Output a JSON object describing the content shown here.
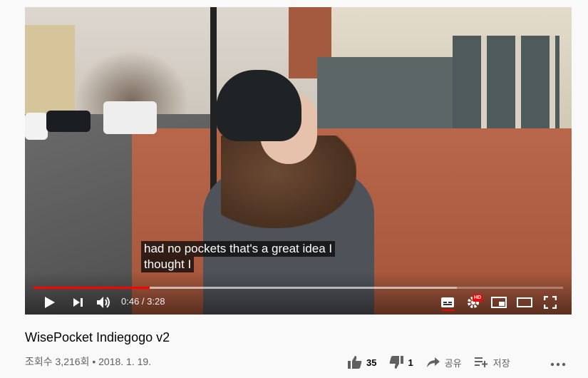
{
  "video": {
    "caption_line1": "had no pockets that's a great idea I",
    "caption_line2": "thought I",
    "current_time": "0:46",
    "duration": "3:28",
    "time_display": "0:46 / 3:28",
    "progress_played": 0.22,
    "progress_loaded": 0.8,
    "hd_badge": "HD"
  },
  "info": {
    "title": "WisePocket Indiegogo v2",
    "meta": "조회수 3,216회 • 2018. 1. 19."
  },
  "actions": {
    "like_count": "35",
    "dislike_count": "1",
    "share_label": "공유",
    "save_label": "저장"
  },
  "colors": {
    "accent": "#ff0000",
    "page_bg": "#f9f9f9",
    "title_text": "#030303",
    "meta_text": "#606060"
  },
  "icons": [
    "play-icon",
    "next-icon",
    "volume-icon",
    "subtitles-icon",
    "settings-icon",
    "miniplayer-icon",
    "theater-icon",
    "fullscreen-icon",
    "thumbs-up-icon",
    "thumbs-down-icon",
    "share-icon",
    "save-playlist-icon",
    "more-icon"
  ]
}
